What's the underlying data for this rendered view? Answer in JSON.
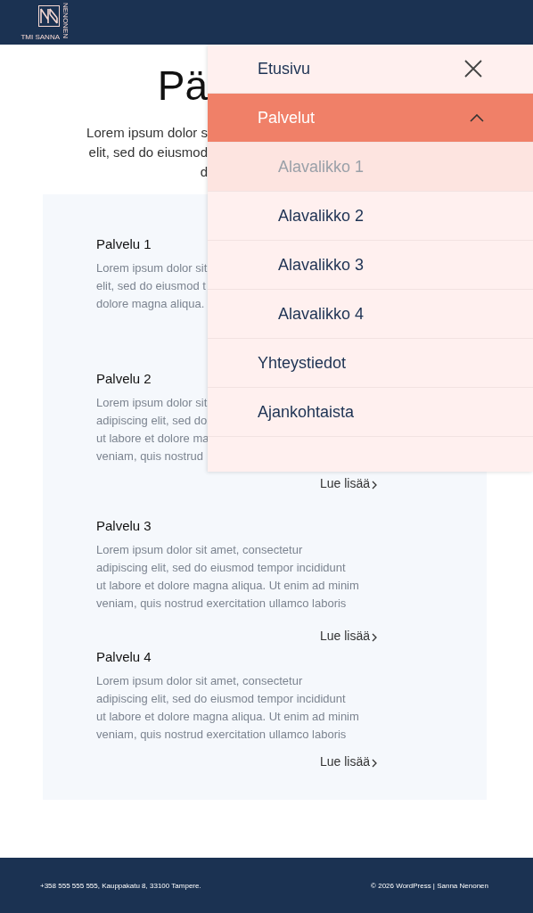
{
  "header": {
    "logo_text": "TMI SANNA",
    "logo_side_text": "NENONEN"
  },
  "hero": {
    "title": "Pä",
    "intro_lines": [
      "Lorem ipsum dolor s",
      "elit, sed do eiusmod",
      "d"
    ]
  },
  "services": [
    {
      "title": "Palvelu 1",
      "lines": [
        "Lorem ipsum dolor sit",
        "elit, sed do eiusmod t",
        "dolore magna aliqua."
      ]
    },
    {
      "title": "Palvelu 2",
      "lines": [
        "Lorem ipsum dolor sit",
        "adipiscing elit, sed do",
        "ut labore et dolore ma",
        "veniam, quis nostrud"
      ],
      "link": "Lue lisää"
    },
    {
      "title": "Palvelu 3",
      "lines": [
        "Lorem ipsum dolor sit amet, consectetur",
        "adipiscing elit, sed do eiusmod tempor incididunt",
        "ut labore et dolore magna aliqua. Ut enim ad minim",
        "veniam, quis nostrud exercitation ullamco laboris"
      ],
      "link": "Lue lisää"
    },
    {
      "title": "Palvelu 4",
      "lines": [
        "Lorem ipsum dolor sit amet, consectetur",
        "adipiscing elit, sed do eiusmod tempor incididunt",
        "ut labore et dolore magna aliqua. Ut enim ad minim",
        "veniam, quis nostrud exercitation ullamco laboris"
      ],
      "link": "Lue lisää"
    }
  ],
  "menu": {
    "items": [
      {
        "label": "Etusivu",
        "selected": false
      },
      {
        "label": "Palvelut",
        "selected": false,
        "expanded": true,
        "children": [
          {
            "label": "Alavalikko 1",
            "selected": true
          },
          {
            "label": "Alavalikko 2",
            "selected": false
          },
          {
            "label": "Alavalikko 3",
            "selected": false
          },
          {
            "label": "Alavalikko 4",
            "selected": false
          }
        ]
      },
      {
        "label": "Yhteystiedot",
        "selected": false
      },
      {
        "label": "Ajankohtaista",
        "selected": false
      }
    ]
  },
  "footer": {
    "contact": "+358 555 555 555, Kauppakatu 8, 33100 Tampere.",
    "copyright": "© 2026 WordPress | Sanna Nenonen"
  }
}
